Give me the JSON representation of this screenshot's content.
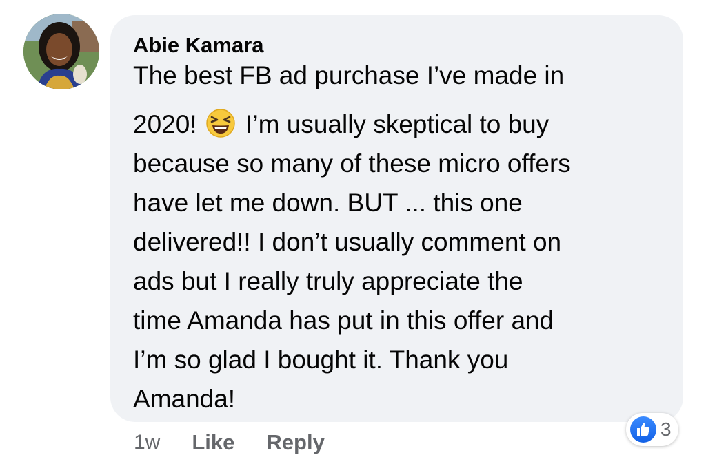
{
  "comment": {
    "author": "Abie Kamara",
    "body_lines": [
      "The best FB ad purchase I’ve made in",
      "2020!",
      "I’m usually skeptical to buy",
      "because so many of these micro offers",
      "have let me down. BUT ... this one",
      "delivered!! I don’t usually comment on",
      "ads but I really truly appreciate the",
      "time Amanda has put in this offer and",
      "I’m so glad I bought it. Thank you",
      "Amanda!"
    ],
    "emoji": "laughing-squinting-emoji",
    "timestamp": "1w",
    "like_label": "Like",
    "reply_label": "Reply",
    "reaction_count": "3",
    "reaction_icon": "thumbs-up-icon"
  },
  "colors": {
    "bubble_bg": "#f0f2f5",
    "text": "#050505",
    "secondary_text": "#65676b",
    "like_blue": "#1877f2"
  }
}
